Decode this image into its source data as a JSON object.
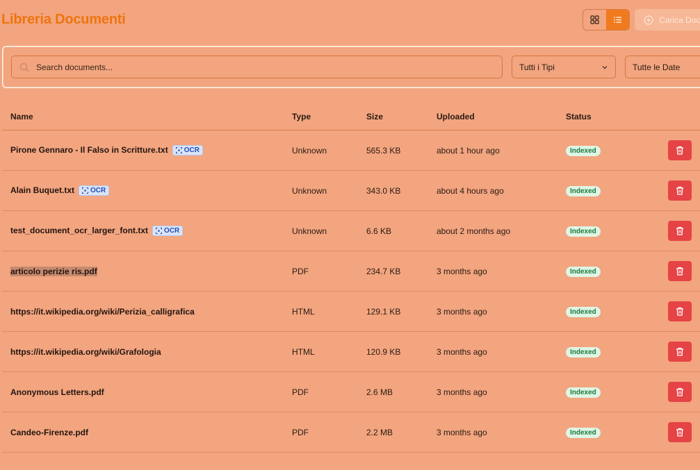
{
  "header": {
    "title": "Libreria Documenti",
    "upload_label": "Carica Doc"
  },
  "filters": {
    "search_placeholder": "Search documents...",
    "type_value": "Tutti i Tipi",
    "date_value": "Tutte le Date"
  },
  "table": {
    "columns": [
      "Name",
      "Type",
      "Size",
      "Uploaded",
      "Status"
    ],
    "ocr_label": "OCR",
    "rows": [
      {
        "name": "Pirone Gennaro - Il Falso in Scritture.txt",
        "ocr": true,
        "type": "Unknown",
        "size": "565.3 KB",
        "uploaded": "about 1 hour ago",
        "status": "Indexed"
      },
      {
        "name": "Alain Buquet.txt",
        "ocr": true,
        "type": "Unknown",
        "size": "343.0 KB",
        "uploaded": "about 4 hours ago",
        "status": "Indexed"
      },
      {
        "name": "test_document_ocr_larger_font.txt",
        "ocr": true,
        "type": "Unknown",
        "size": "6.6 KB",
        "uploaded": "about 2 months ago",
        "status": "Indexed"
      },
      {
        "name": "articolo perizie ris.pdf",
        "ocr": false,
        "selected": true,
        "type": "PDF",
        "size": "234.7 KB",
        "uploaded": "3 months ago",
        "status": "Indexed"
      },
      {
        "name": "https://it.wikipedia.org/wiki/Perizia_calligrafica",
        "ocr": false,
        "type": "HTML",
        "size": "129.1 KB",
        "uploaded": "3 months ago",
        "status": "Indexed"
      },
      {
        "name": "https://it.wikipedia.org/wiki/Grafologia",
        "ocr": false,
        "type": "HTML",
        "size": "120.9 KB",
        "uploaded": "3 months ago",
        "status": "Indexed"
      },
      {
        "name": "Anonymous Letters.pdf",
        "ocr": false,
        "type": "PDF",
        "size": "2.6 MB",
        "uploaded": "3 months ago",
        "status": "Indexed"
      },
      {
        "name": "Candeo-Firenze.pdf",
        "ocr": false,
        "type": "PDF",
        "size": "2.2 MB",
        "uploaded": "3 months ago",
        "status": "Indexed"
      }
    ]
  },
  "colors": {
    "background": "#f2a57f",
    "accent": "#ee7410",
    "delete": "#e64346",
    "status_bg": "#dff5e5",
    "ocr_bg": "#dbe4f7"
  }
}
